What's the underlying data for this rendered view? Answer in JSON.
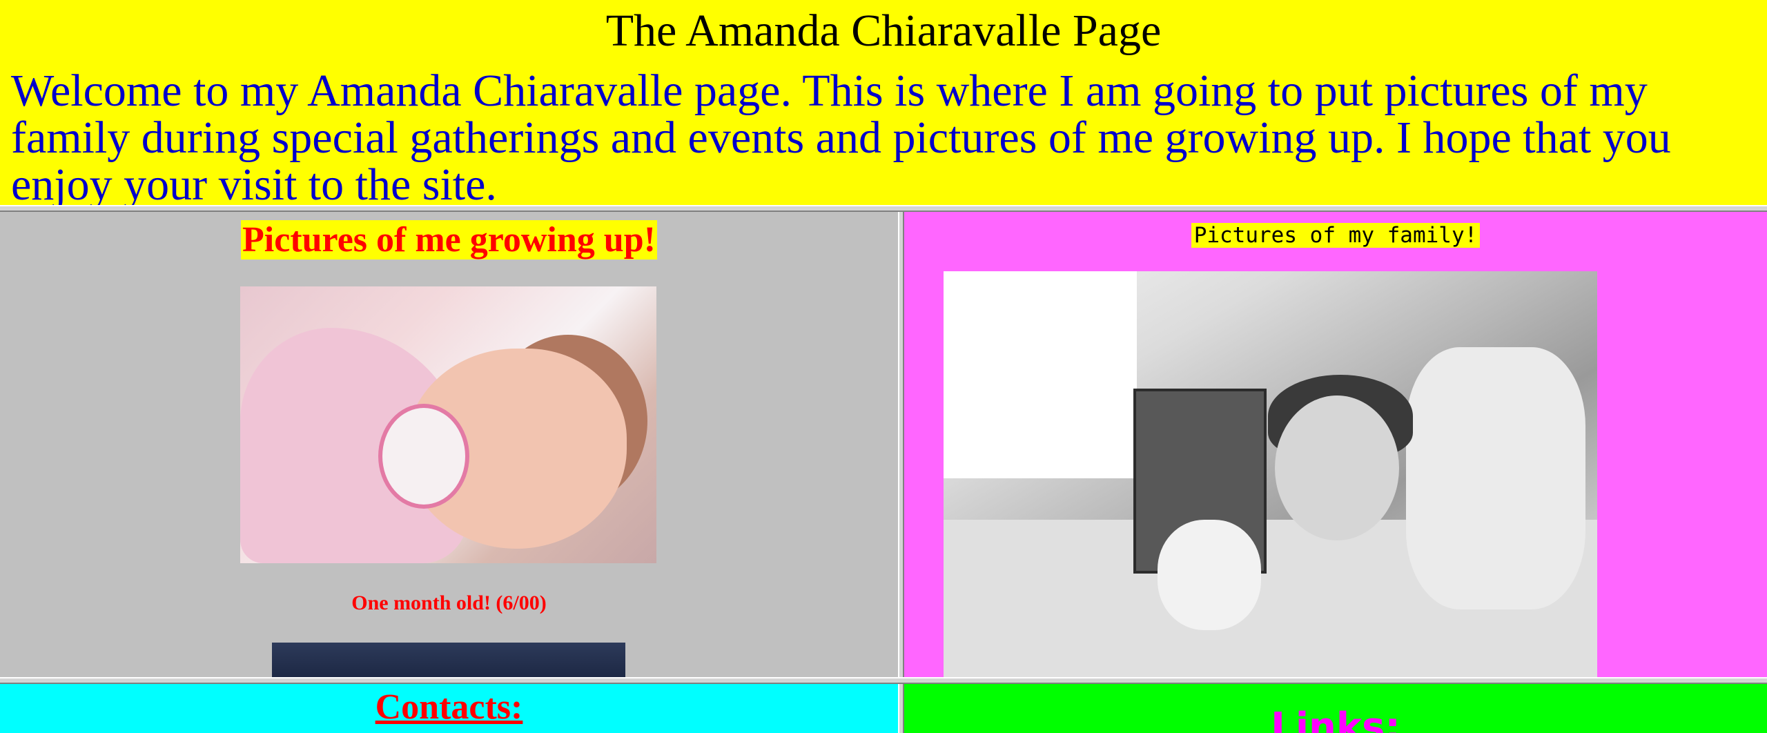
{
  "top": {
    "title": "The Amanda Chiaravalle Page",
    "welcome": "Welcome to my Amanda Chiaravalle page.  This is where I am going to put pictures of my family during special gatherings and events and pictures of me growing up.  I hope that you enjoy your visit to the site."
  },
  "left": {
    "heading": "Pictures of me growing up!",
    "caption": "One month old!  (6/00)"
  },
  "right": {
    "heading": "Pictures of my family!"
  },
  "bottom_left": {
    "heading": "Contacts:"
  },
  "bottom_right": {
    "heading": "Links:"
  },
  "colors": {
    "top_bg": "#ffff00",
    "welcome_text": "#0000cc",
    "left_bg": "#c0c0c0",
    "right_bg": "#ff66ff",
    "contacts_bg": "#00ffff",
    "links_bg": "#00ff00",
    "heading_red": "#ff0000",
    "links_magenta": "#ff00ff"
  }
}
